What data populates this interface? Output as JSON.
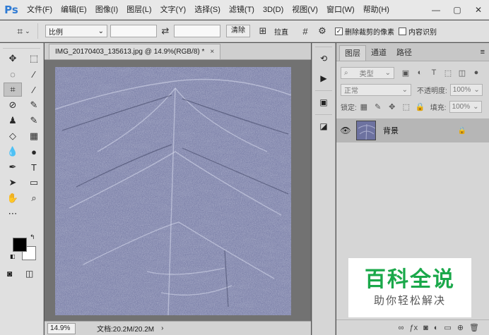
{
  "app": {
    "logo": "Ps",
    "menu": [
      "文件(F)",
      "编辑(E)",
      "图像(I)",
      "图层(L)",
      "文字(Y)",
      "选择(S)",
      "滤镜(T)",
      "3D(D)",
      "视图(V)",
      "窗口(W)",
      "帮助(H)"
    ],
    "window_controls": [
      "—",
      "▢",
      "✕"
    ]
  },
  "options_bar": {
    "tool_icon": "crop-icon",
    "ratio_select": "比例",
    "clear_button": "清除",
    "straighten_label": "拉直",
    "delete_cropped_label": "删除裁剪的像素",
    "delete_cropped_checked": true,
    "content_aware_label": "内容识别"
  },
  "toolbar": {
    "tools": [
      [
        "move-icon",
        "marquee-icon"
      ],
      [
        "lasso-icon",
        "magic-wand-icon"
      ],
      [
        "crop-icon",
        "eyedropper-icon"
      ],
      [
        "healing-brush-icon",
        "brush-icon"
      ],
      [
        "clone-stamp-icon",
        "history-brush-icon"
      ],
      [
        "eraser-icon",
        "gradient-icon"
      ],
      [
        "blur-icon",
        "dodge-icon"
      ],
      [
        "pen-icon",
        "type-icon"
      ],
      [
        "path-selection-icon",
        "rectangle-icon"
      ],
      [
        "hand-icon",
        "zoom-icon"
      ],
      [
        "more-tools-icon"
      ]
    ],
    "foreground_color": "#000000",
    "background_color": "#ffffff"
  },
  "document": {
    "tab_title": "IMG_20170403_135613.jpg @ 14.9%(RGB/8) *",
    "tab_close": "×",
    "zoom": "14.9%",
    "doc_size": "文档:20.2M/20.2M",
    "status_arrow": "›",
    "image_tint": "#6a6f97"
  },
  "layers_panel": {
    "tabs": [
      "图层",
      "通道",
      "路径"
    ],
    "active_tab": "图层",
    "filter_placeholder": "类型",
    "blend_mode": "正常",
    "opacity_label": "不透明度:",
    "opacity_value": "100%",
    "lock_label": "锁定:",
    "fill_label": "填充:",
    "fill_value": "100%",
    "layer": {
      "name": "背景",
      "visible": true,
      "locked": true
    }
  },
  "watermark": {
    "title": "百科全说",
    "subtitle": "助你轻松解决",
    "title_color": "#1aa84a"
  }
}
